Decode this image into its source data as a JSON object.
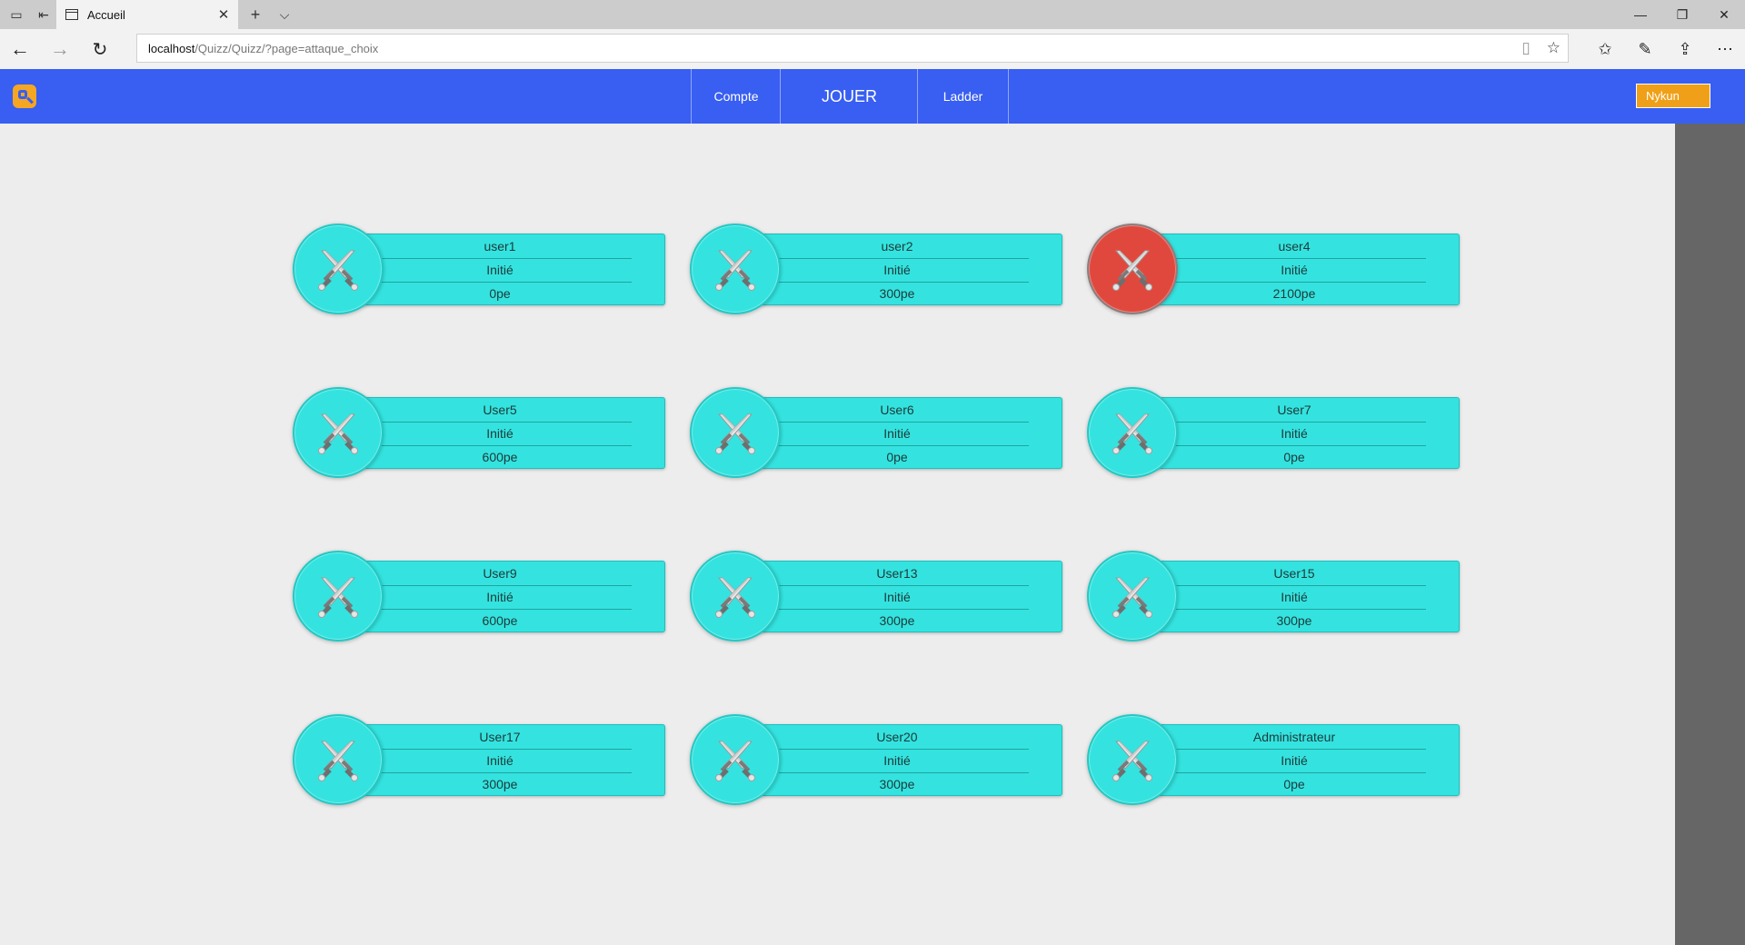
{
  "browser": {
    "tab_title": "Accueil",
    "url_host": "localhost",
    "url_path": "/Quizz/Quizz/?page=attaque_choix"
  },
  "header": {
    "nav": {
      "compte": "Compte",
      "jouer": "JOUER",
      "ladder": "Ladder"
    },
    "user_button": "Nykun",
    "colors": {
      "bar": "#385ef2",
      "user_button": "#f0a018"
    }
  },
  "opponents": [
    {
      "name": "user1",
      "rank": "Initié",
      "points": "0pe"
    },
    {
      "name": "user2",
      "rank": "Initié",
      "points": "300pe"
    },
    {
      "name": "user4",
      "rank": "Initié",
      "points": "2100pe",
      "highlighted": true
    },
    {
      "name": "User5",
      "rank": "Initié",
      "points": "600pe"
    },
    {
      "name": "User6",
      "rank": "Initié",
      "points": "0pe"
    },
    {
      "name": "User7",
      "rank": "Initié",
      "points": "0pe"
    },
    {
      "name": "User9",
      "rank": "Initié",
      "points": "600pe"
    },
    {
      "name": "User13",
      "rank": "Initié",
      "points": "300pe"
    },
    {
      "name": "User15",
      "rank": "Initié",
      "points": "300pe"
    },
    {
      "name": "User17",
      "rank": "Initié",
      "points": "300pe"
    },
    {
      "name": "User20",
      "rank": "Initié",
      "points": "300pe"
    },
    {
      "name": "Administrateur",
      "rank": "Initié",
      "points": "0pe"
    }
  ],
  "card_icon": "crossed-swords-icon",
  "colors": {
    "card": "#34e3df",
    "card_active": "#e0483e"
  }
}
